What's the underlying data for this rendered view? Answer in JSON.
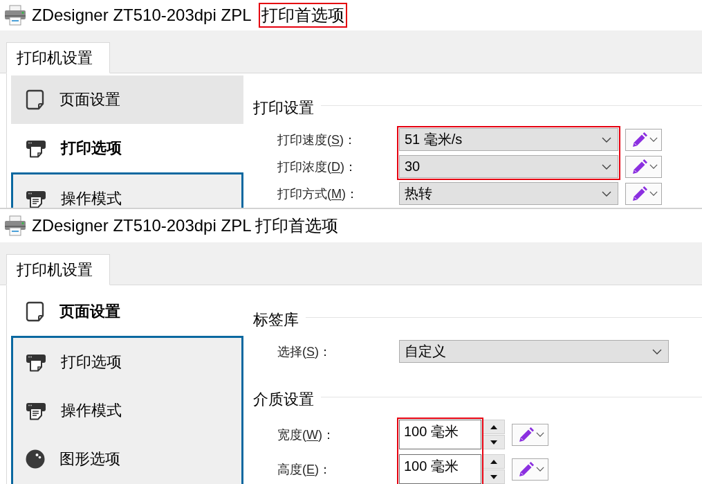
{
  "windows": [
    {
      "title_parts": [
        {
          "text": "ZDesigner ZT510-203dpi ZPL",
          "highlighted": false
        },
        {
          "text": "打印首选项",
          "highlighted": true
        }
      ],
      "tabs": [
        {
          "label": "打印机设置",
          "selected": true
        }
      ],
      "nav_items": [
        {
          "kind": "page",
          "label": "页面设置",
          "selected": false
        },
        {
          "kind": "print",
          "label": "打印选项",
          "selected": true
        },
        {
          "kind": "mode",
          "label": "操作模式",
          "selected": false
        }
      ],
      "sections": [
        {
          "heading": "打印设置",
          "fields": [
            {
              "kind": "dropdown",
              "label_before": "打印速度(",
              "access_key": "S",
              "label_after": ")：",
              "value": "51 毫米/s",
              "highlighted": true,
              "preset_button": true
            },
            {
              "kind": "dropdown",
              "label_before": "打印浓度(",
              "access_key": "D",
              "label_after": ")：",
              "value": "30",
              "highlighted": true,
              "preset_button": true
            },
            {
              "kind": "dropdown",
              "label_before": "打印方式(",
              "access_key": "M",
              "label_after": ")：",
              "value": "热转",
              "highlighted": false,
              "preset_button": true
            }
          ]
        }
      ]
    },
    {
      "title_parts": [
        {
          "text": "ZDesigner ZT510-203dpi ZPL 打印首选项",
          "highlighted": false
        }
      ],
      "tabs": [
        {
          "label": "打印机设置",
          "selected": true
        }
      ],
      "nav_items": [
        {
          "kind": "page",
          "label": "页面设置",
          "selected": true
        },
        {
          "kind": "print",
          "label": "打印选项",
          "selected": false
        },
        {
          "kind": "mode",
          "label": "操作模式",
          "selected": false
        },
        {
          "kind": "graphics",
          "label": "图形选项",
          "selected": false
        }
      ],
      "sections": [
        {
          "heading": "标签库",
          "fields": [
            {
              "kind": "dropdown",
              "label_before": "选择(",
              "access_key": "S",
              "label_after": ")：",
              "value": "自定义",
              "highlighted": false,
              "preset_button": false
            }
          ]
        },
        {
          "heading": "介质设置",
          "fields": [
            {
              "kind": "spin",
              "label_before": "宽度(",
              "access_key": "W",
              "label_after": ")：",
              "value": "100 毫米",
              "highlighted": true,
              "preset_button": true
            },
            {
              "kind": "spin",
              "label_before": "高度(",
              "access_key": "E",
              "label_after": ")：",
              "value": "100 毫米",
              "highlighted": true,
              "preset_button": true
            }
          ]
        }
      ]
    }
  ]
}
